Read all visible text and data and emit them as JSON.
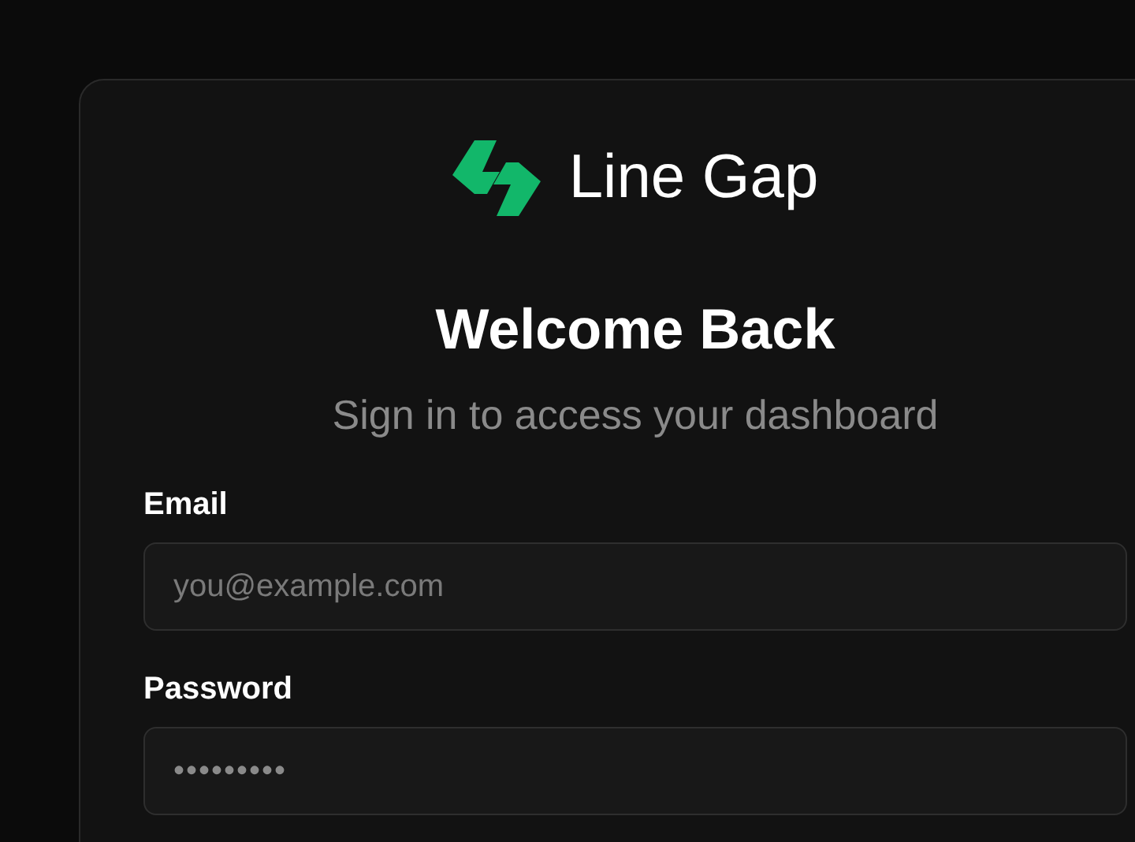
{
  "brand": {
    "name": "Line Gap"
  },
  "heading": "Welcome Back",
  "subheading": "Sign in to access your dashboard",
  "fields": [
    {
      "label": "Email",
      "placeholder": "you@example.com",
      "kind": "email"
    },
    {
      "label": "Password",
      "placeholder": "•••••••••",
      "kind": "password"
    }
  ]
}
